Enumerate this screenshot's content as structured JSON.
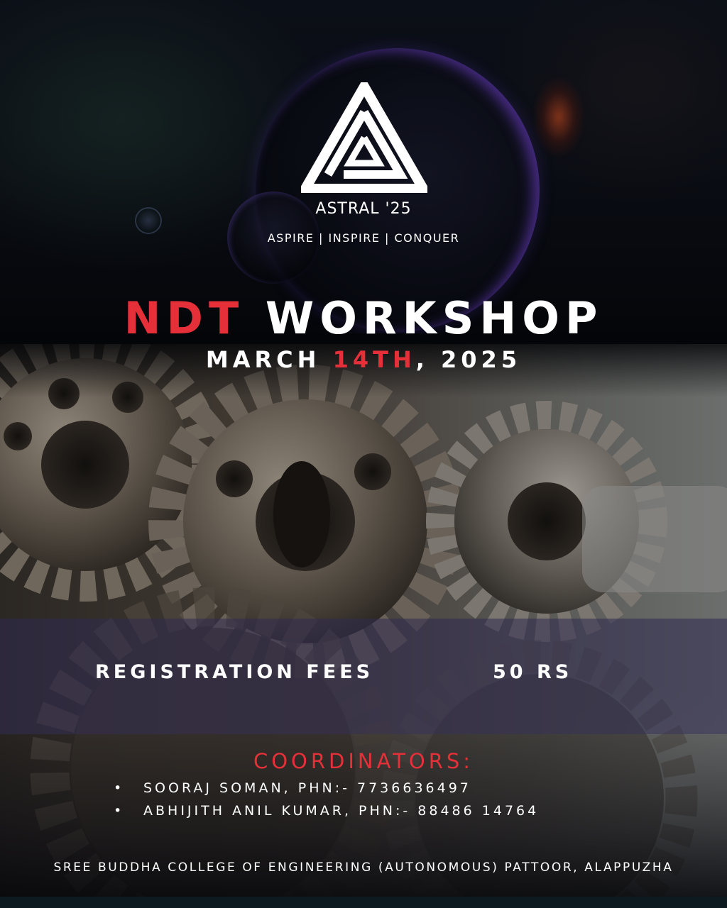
{
  "brand": {
    "name": "ASTRAL '25",
    "tagline": "ASPIRE | INSPIRE | CONQUER",
    "logo_icon": "astral-triangle-logo"
  },
  "event": {
    "title_part1": "NDT",
    "title_part2": " WORKSHOP",
    "date_month": "MARCH ",
    "date_day": "14TH",
    "date_year": ", 2025"
  },
  "registration": {
    "label": "REGISTRATION FEES",
    "fee": "50 RS"
  },
  "coordinators": {
    "title": "COORDINATORS:",
    "bullet": "•",
    "people": [
      {
        "text": "SOORAJ SOMAN, PHN:- 7736636497"
      },
      {
        "text": "ABHIJITH ANIL KUMAR, PHN:- 88486 14764"
      }
    ]
  },
  "footer": {
    "college": "SREE BUDDHA COLLEGE OF ENGINEERING (AUTONOMOUS) PATTOOR, ALAPPUZHA"
  },
  "colors": {
    "accent_red": "#e5303a",
    "text_white": "#ffffff",
    "background_dark": "#06080d",
    "band_purple": "#302a50"
  }
}
